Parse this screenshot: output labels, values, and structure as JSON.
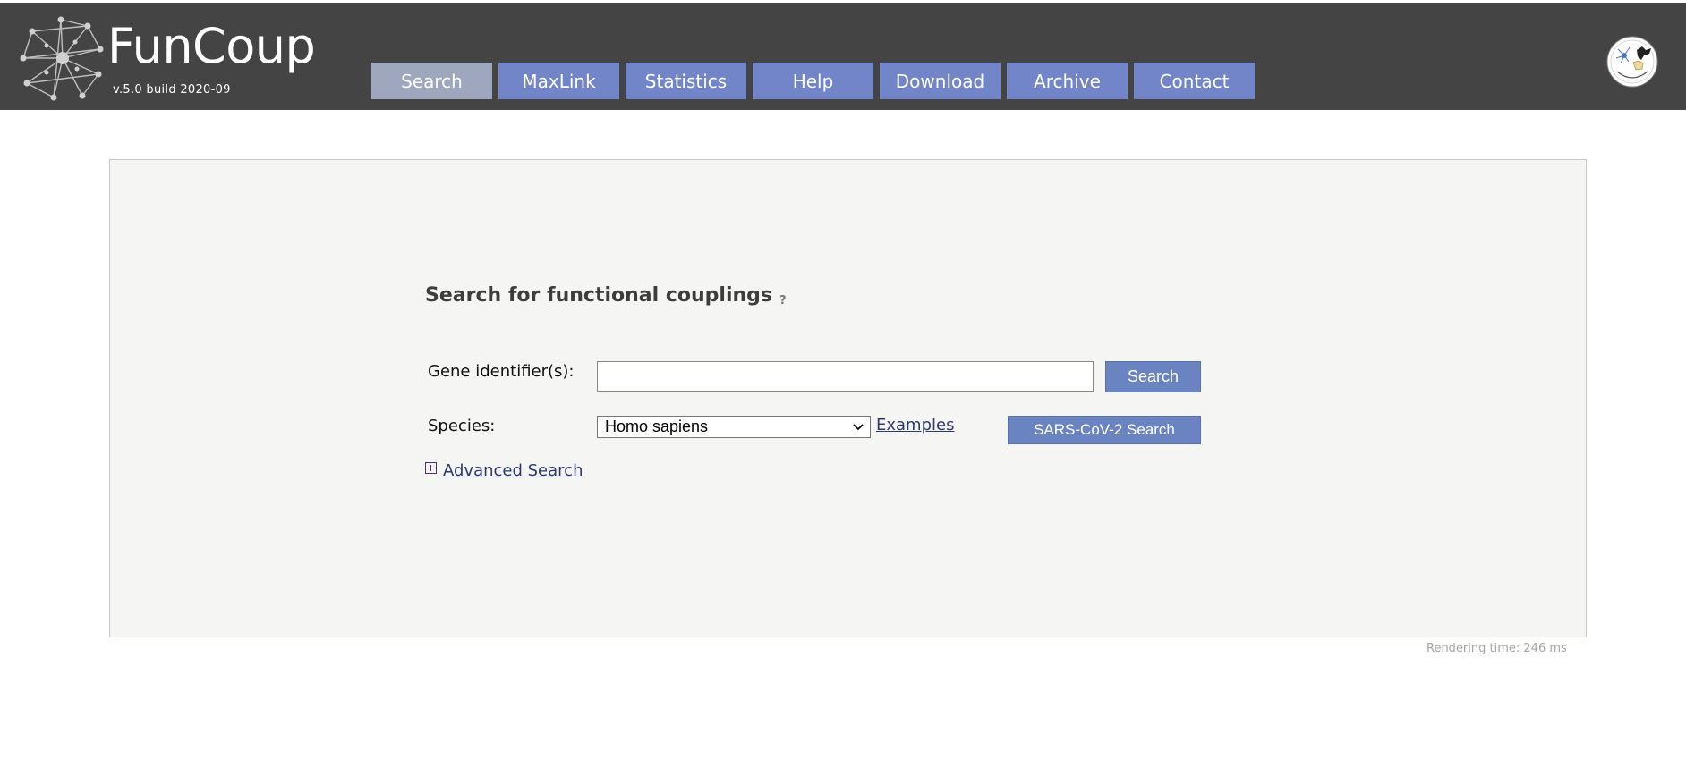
{
  "header": {
    "app_name": "FunCoup",
    "version": "v.5.0 build 2020-09",
    "nav": [
      {
        "label": "Search",
        "active": true
      },
      {
        "label": "MaxLink",
        "active": false
      },
      {
        "label": "Statistics",
        "active": false
      },
      {
        "label": "Help",
        "active": false
      },
      {
        "label": "Download",
        "active": false
      },
      {
        "label": "Archive",
        "active": false
      },
      {
        "label": "Contact",
        "active": false
      }
    ],
    "badge_icon": "sonnhammer-org-logo"
  },
  "search": {
    "title": "Search for functional couplings",
    "help_glyph": "?",
    "gene_label": "Gene identifier(s):",
    "gene_value": "",
    "search_button": "Search",
    "species_label": "Species:",
    "species_selected": "Homo sapiens",
    "examples_link": "Examples",
    "sars_button": "SARS-CoV-2 Search",
    "advanced_link": "Advanced Search"
  },
  "footer": {
    "render_time": "Rendering time: 246 ms"
  },
  "colors": {
    "topbar": "#444444",
    "nav": "#7285c8",
    "nav_active": "#9ea7bd",
    "button": "#6a84c1",
    "panel": "#f5f5f4"
  }
}
